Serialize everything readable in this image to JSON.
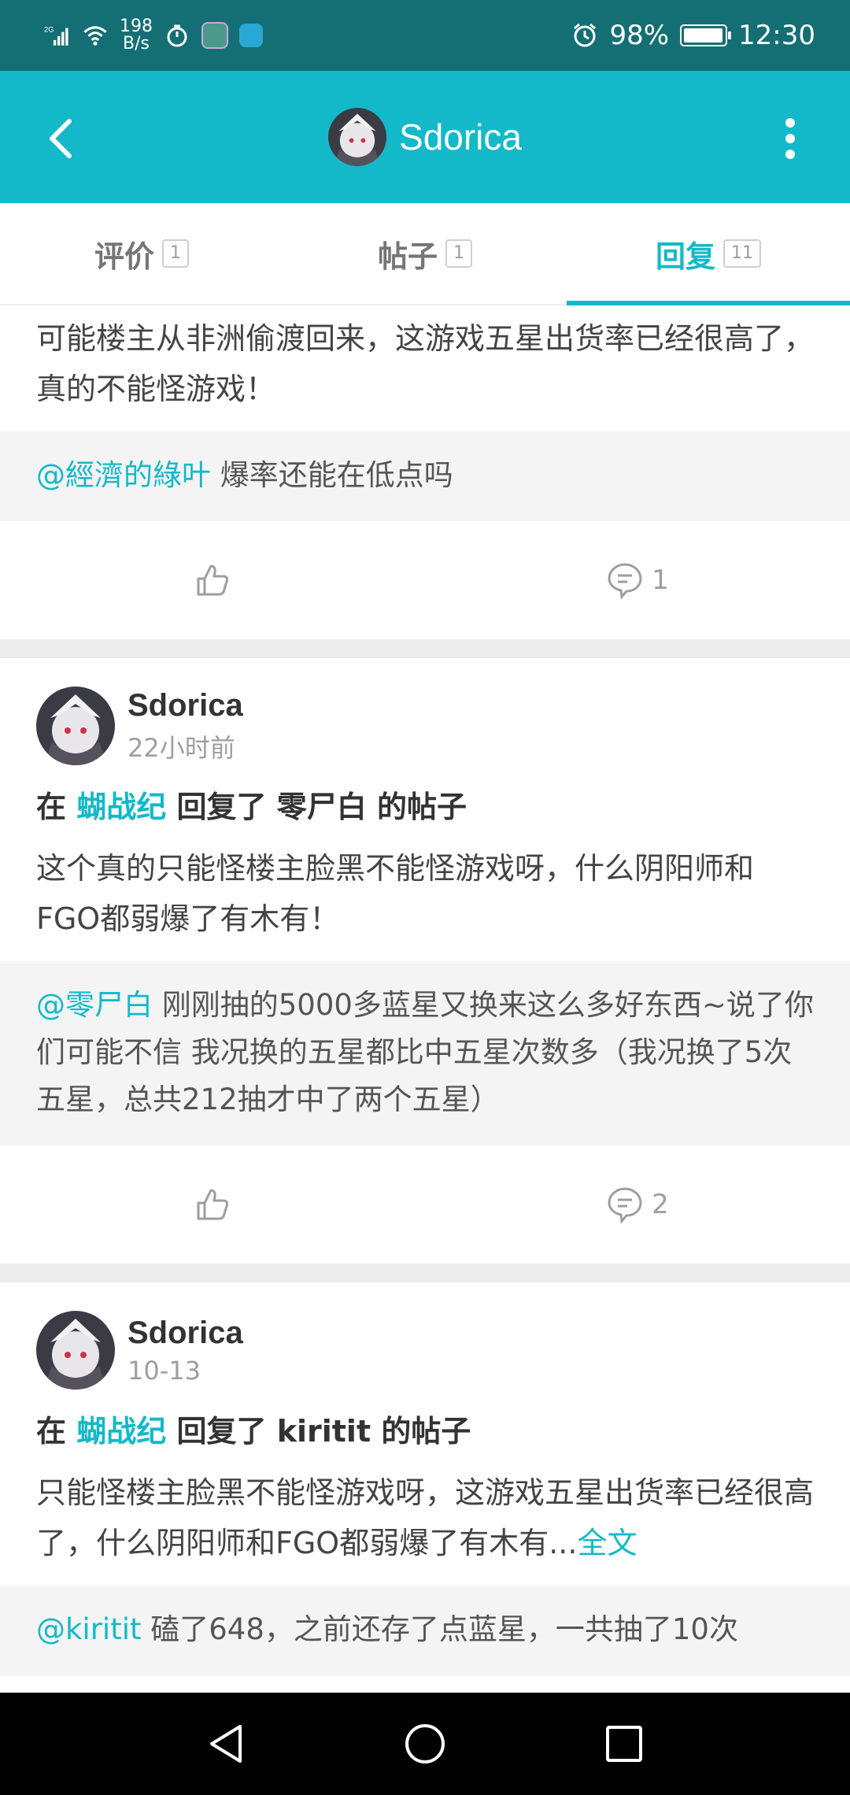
{
  "status_bar": {
    "network": "2G",
    "data_rate_value": "198",
    "data_rate_unit": "B/s",
    "battery_percent": "98%",
    "battery_level": 0.98,
    "time": "12:30"
  },
  "header": {
    "title": "Sdorica"
  },
  "tabs": [
    {
      "label": "评价",
      "count": "1"
    },
    {
      "label": "帖子",
      "count": "1"
    },
    {
      "label": "回复",
      "count": "11",
      "active": true
    }
  ],
  "feed": {
    "item0": {
      "body": "可能楼主从非洲偷渡回来，这游戏五星出货率已经很高了，真的不能怪游戏！",
      "quote_mention": "@經濟的綠叶",
      "quote_text": " 爆率还能在低点吗",
      "comment_count": "1"
    },
    "item1": {
      "author": "Sdorica",
      "time": "22小时前",
      "prefix": "在 ",
      "game": "蝴战纪",
      "suffix": " 回复了 零尸白 的帖子",
      "body": "这个真的只能怪楼主脸黑不能怪游戏呀，什么阴阳师和FGO都弱爆了有木有！",
      "quote_mention": "@零尸白",
      "quote_text": " 刚刚抽的5000多蓝星又换来这么多好东西~说了你们可能不信 我况换的五星都比中五星次数多（我况换了5次五星，总共212抽才中了两个五星）",
      "comment_count": "2"
    },
    "item2": {
      "author": "Sdorica",
      "time": "10-13",
      "prefix": "在 ",
      "game": "蝴战纪",
      "suffix": " 回复了 kiritit 的帖子",
      "body": "只能怪楼主脸黑不能怪游戏呀，这游戏五星出货率已经很高了，什么阴阳师和FGO都弱爆了有木有...",
      "more": "全文",
      "quote_mention": "@kiritit",
      "quote_text": " 磕了648，之前还存了点蓝星，一共抽了10次"
    }
  }
}
